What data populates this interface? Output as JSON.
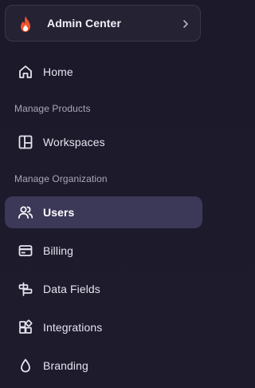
{
  "switcher": {
    "title": "Admin Center",
    "logo_icon": "flame-icon",
    "chevron_icon": "chevron-right-icon"
  },
  "nav": {
    "home": {
      "label": "Home",
      "icon": "home-icon"
    },
    "section_products": "Manage Products",
    "workspaces": {
      "label": "Workspaces",
      "icon": "workspace-layout-icon"
    },
    "section_organization": "Manage Organization",
    "users": {
      "label": "Users",
      "icon": "users-icon",
      "active": true
    },
    "billing": {
      "label": "Billing",
      "icon": "credit-card-icon"
    },
    "data_fields": {
      "label": "Data Fields",
      "icon": "data-fields-icon"
    },
    "integrations": {
      "label": "Integrations",
      "icon": "integrations-icon"
    },
    "branding": {
      "label": "Branding",
      "icon": "droplet-icon"
    }
  },
  "colors": {
    "background": "#1c1a2a",
    "active_bg": "#3c3858",
    "accent_flame": "#f0542c"
  }
}
